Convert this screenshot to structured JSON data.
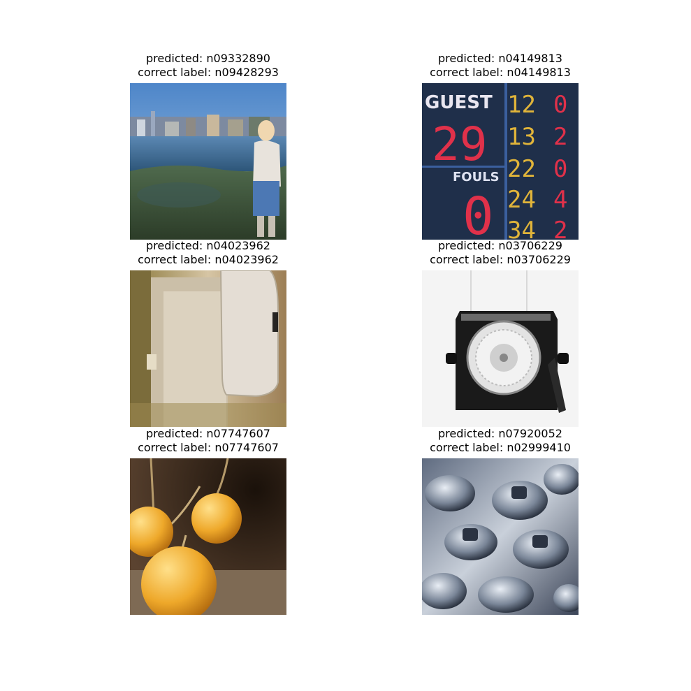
{
  "panels": [
    {
      "predicted": "predicted: n09332890",
      "correct": "correct label: n09428293",
      "scene": "lakeside-person-photo"
    },
    {
      "predicted": "predicted: n04149813",
      "correct": "correct label: n04149813",
      "scene": "scoreboard-photo",
      "scoreboard_text": {
        "guest": "GUEST",
        "score": "29",
        "fouls": "FOULS",
        "fouls_value": "0",
        "col_a": [
          "12",
          "13",
          "22",
          "24",
          "34"
        ],
        "col_b": [
          "0",
          "2",
          "0",
          "4",
          "2"
        ]
      }
    },
    {
      "predicted": "predicted: n04023962",
      "correct": "correct label: n04023962",
      "scene": "bathroom-stall-photo"
    },
    {
      "predicted": "predicted: n03706229",
      "correct": "correct label: n03706229",
      "scene": "compass-photo"
    },
    {
      "predicted": "predicted: n07747607",
      "correct": "correct label: n07747607",
      "scene": "oranges-photo"
    },
    {
      "predicted": "predicted: n07920052",
      "correct": "correct label: n02999410",
      "scene": "metal-parts-photo"
    }
  ]
}
